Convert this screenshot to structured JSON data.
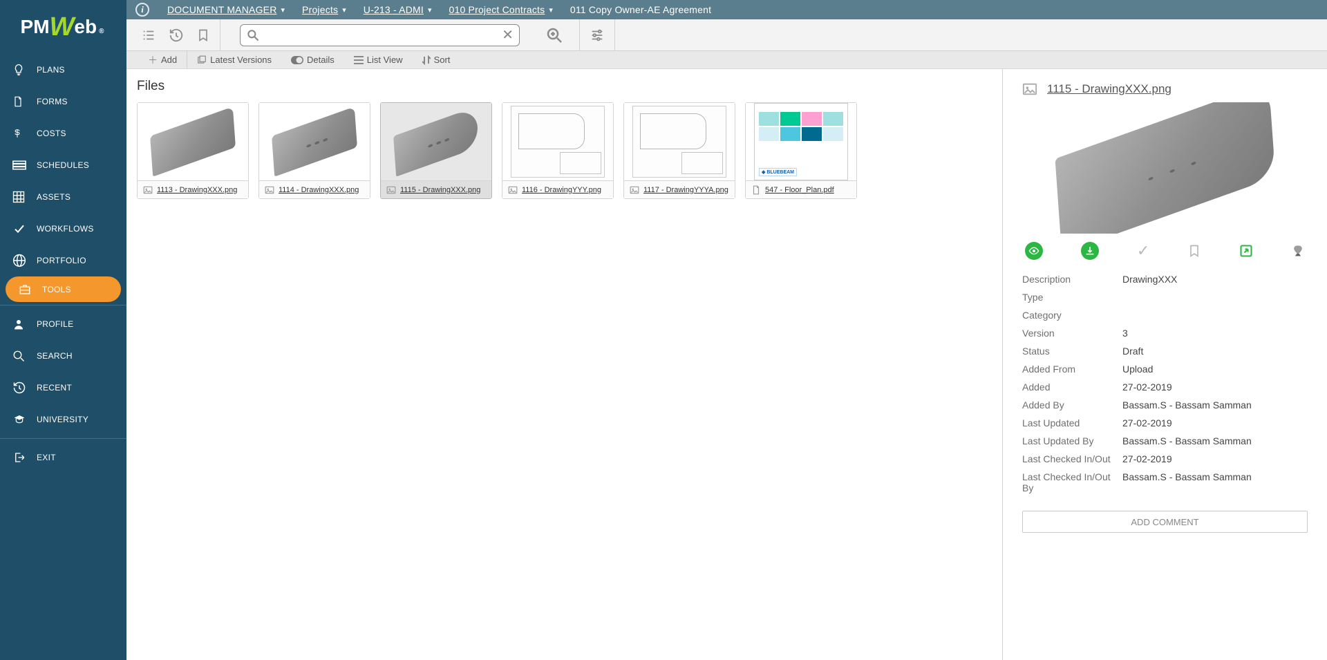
{
  "logo": {
    "pm": "PM",
    "w": "W",
    "eb": "eb"
  },
  "breadcrumbs": [
    {
      "label": "DOCUMENT MANAGER",
      "dropdown": true,
      "link": true
    },
    {
      "label": "Projects",
      "dropdown": true,
      "link": true
    },
    {
      "label": "U-213 - ADMI",
      "dropdown": true,
      "link": true
    },
    {
      "label": "010 Project Contracts",
      "dropdown": true,
      "link": true
    },
    {
      "label": "011 Copy Owner-AE Agreement",
      "dropdown": false,
      "link": false
    }
  ],
  "sidebar": {
    "items": [
      {
        "id": "plans",
        "label": "PLANS",
        "icon": "bulb"
      },
      {
        "id": "forms",
        "label": "FORMS",
        "icon": "sheet"
      },
      {
        "id": "costs",
        "label": "COSTS",
        "icon": "dollar"
      },
      {
        "id": "schedules",
        "label": "SCHEDULES",
        "icon": "rows"
      },
      {
        "id": "assets",
        "label": "ASSETS",
        "icon": "grid"
      },
      {
        "id": "workflows",
        "label": "WORKFLOWS",
        "icon": "check"
      },
      {
        "id": "portfolio",
        "label": "PORTFOLIO",
        "icon": "globe"
      },
      {
        "id": "tools",
        "label": "TOOLS",
        "icon": "briefcase",
        "active": true
      }
    ],
    "items2": [
      {
        "id": "profile",
        "label": "PROFILE",
        "icon": "user"
      },
      {
        "id": "search",
        "label": "SEARCH",
        "icon": "search"
      },
      {
        "id": "recent",
        "label": "RECENT",
        "icon": "history"
      },
      {
        "id": "university",
        "label": "UNIVERSITY",
        "icon": "grad"
      }
    ],
    "items3": [
      {
        "id": "exit",
        "label": "EXIT",
        "icon": "exit"
      }
    ]
  },
  "toolbar": {
    "add": "Add",
    "latest": "Latest Versions",
    "details": "Details",
    "listview": "List View",
    "sort": "Sort"
  },
  "files": {
    "heading": "Files",
    "items": [
      {
        "id": "f1",
        "name": "1113 - DrawingXXX.png",
        "type": "img3d",
        "selected": false
      },
      {
        "id": "f2",
        "name": "1114 - DrawingXXX.png",
        "type": "img3d_dots",
        "selected": false
      },
      {
        "id": "f3",
        "name": "1115 - DrawingXXX.png",
        "type": "img3d_round",
        "selected": true
      },
      {
        "id": "f4",
        "name": "1116 - DrawingYYY.png",
        "type": "drawing",
        "selected": false
      },
      {
        "id": "f5",
        "name": "1117 - DrawingYYYA.png",
        "type": "drawing",
        "selected": false
      },
      {
        "id": "f6",
        "name": "547 - Floor_Plan.pdf",
        "type": "floorplan",
        "fileicon": "pdf",
        "selected": false
      }
    ]
  },
  "detail": {
    "title": "1115 - DrawingXXX.png",
    "fields": {
      "Description": "DrawingXXX",
      "Type": "",
      "Category": "",
      "Version": "3",
      "Status": "Draft",
      "Added From": "Upload",
      "Added": "27-02-2019",
      "Added By": "Bassam.S - Bassam Samman",
      "Last Updated": "27-02-2019",
      "Last Updated By": "Bassam.S - Bassam Samman",
      "Last Checked In/Out": "27-02-2019",
      "Last Checked In/Out By": "Bassam.S - Bassam Samman"
    },
    "add_comment": "ADD COMMENT"
  },
  "search": {
    "placeholder": ""
  }
}
